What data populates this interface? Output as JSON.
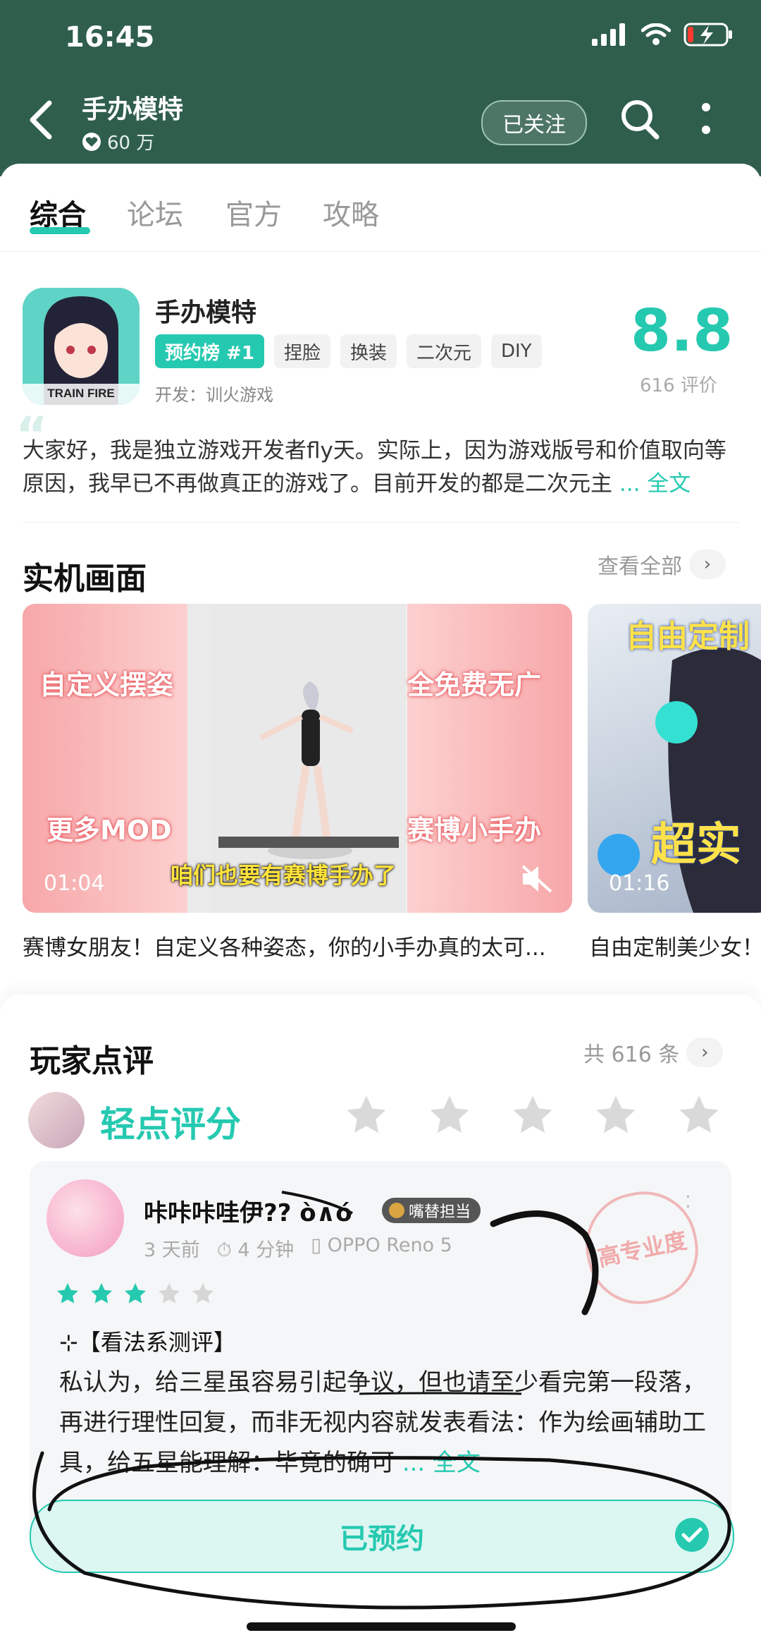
{
  "status_bar": {
    "time": "16:45"
  },
  "header": {
    "title": "手办模特",
    "fans": "60 万",
    "follow_label": "已关注"
  },
  "tabs": [
    "综合",
    "论坛",
    "官方",
    "攻略"
  ],
  "app": {
    "name": "手办模特",
    "icon_text": "TRAIN FIRE",
    "tags": [
      "预约榜 #1",
      "捏脸",
      "换装",
      "二次元",
      "DIY"
    ],
    "developer": "开发：训火游戏",
    "score": "8.8",
    "rating_count": "616 评价",
    "description": "大家好，我是独立游戏开发者fly天。实际上，因为游戏版号和价值取向等原因，我早已不再做真正的游戏了。目前开发的都是二次元主",
    "full_text_link": "... 全文"
  },
  "screenshots": {
    "title": "实机画面",
    "see_all": "查看全部",
    "videos": [
      {
        "duration": "01:04",
        "labels": [
          "自定义摆姿",
          "全免费无广",
          "更多MOD",
          "赛博小手办"
        ],
        "subtitle": "咱们也要有赛博手办了",
        "caption": "赛博女朋友！自定义各种姿态，你的小手办真的太可..."
      },
      {
        "duration": "01:16",
        "labels": [
          "自由定制",
          "超实"
        ],
        "caption": "自由定制美少女！"
      }
    ]
  },
  "reviews": {
    "title": "玩家点评",
    "total": "共 616 条",
    "rate_prompt": "轻点评分",
    "item": {
      "user": "咔咔咔哇伊?? ò∧ó",
      "badge": "嘴替担当",
      "time_ago": "3 天前",
      "play_time": "4 分钟",
      "device": "OPPO Reno 5",
      "stars": 3,
      "stamp_text": "高专业度",
      "heading": "⊹【看法系测评】",
      "body": "私认为，给三星虽容易引起争议，但也请至少看完第一段落，再进行理性回复，而非无视内容就发表看法：作为绘画辅助工具，给五星能理解：毕竟的确可",
      "full_text_link": "... 全文"
    }
  },
  "reserve_button": "已预约",
  "colors": {
    "header_bg": "#2f5e4d",
    "accent": "#25c9b0"
  }
}
